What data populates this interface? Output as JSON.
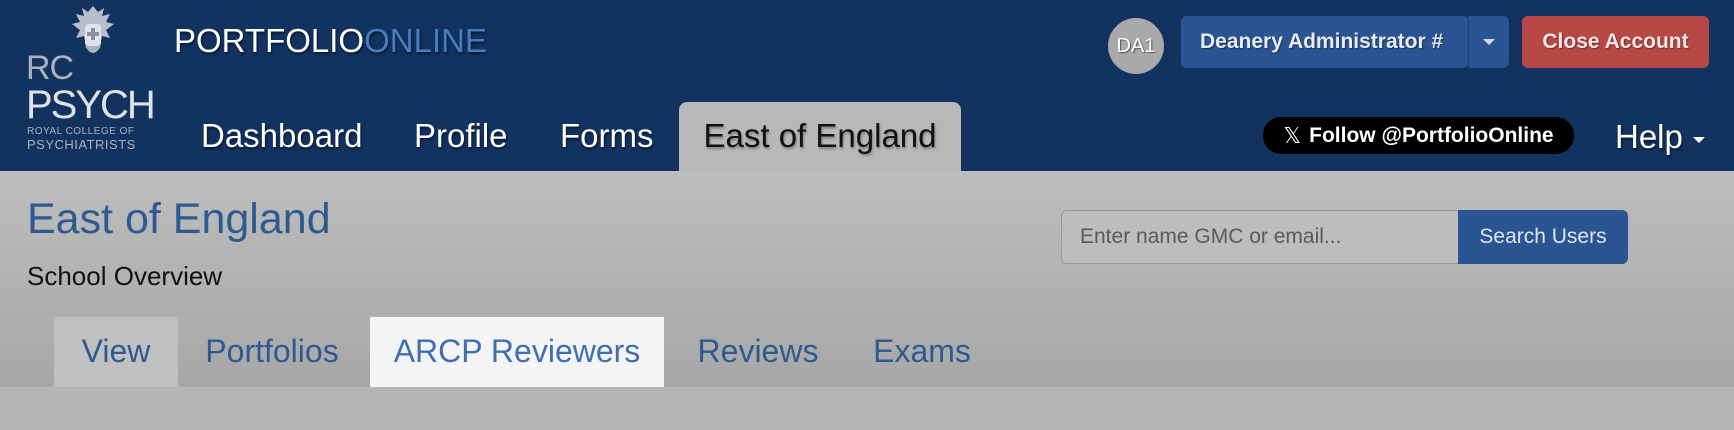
{
  "logo": {
    "line1": "RC",
    "line2": "PSYCH",
    "line3": "ROYAL COLLEGE OF",
    "line4": "PSYCHIATRISTS"
  },
  "brand": {
    "part1": "PORTFOLIO",
    "part2": "ONLINE"
  },
  "user": {
    "avatar_initials": "DA1",
    "name_label": "Deanery Administrator #",
    "close_label": "Close Account"
  },
  "nav": {
    "items": [
      {
        "label": "Dashboard"
      },
      {
        "label": "Profile"
      },
      {
        "label": "Forms"
      },
      {
        "label": "East of England"
      }
    ],
    "follow_label": "Follow @PortfolioOnline",
    "follow_icon": "𝕏",
    "help_label": "Help"
  },
  "page": {
    "title": "East of England",
    "subtitle": "School Overview"
  },
  "search": {
    "placeholder": "Enter name GMC or email...",
    "button_label": "Search Users"
  },
  "tabs": [
    {
      "label": "View"
    },
    {
      "label": "Portfolios"
    },
    {
      "label": "ARCP Reviewers"
    },
    {
      "label": "Reviews"
    },
    {
      "label": "Exams"
    }
  ],
  "colors": {
    "header_bg": "#123260",
    "accent_blue": "#2a5592",
    "close_red": "#b84845",
    "link_blue": "#2e5a92"
  }
}
